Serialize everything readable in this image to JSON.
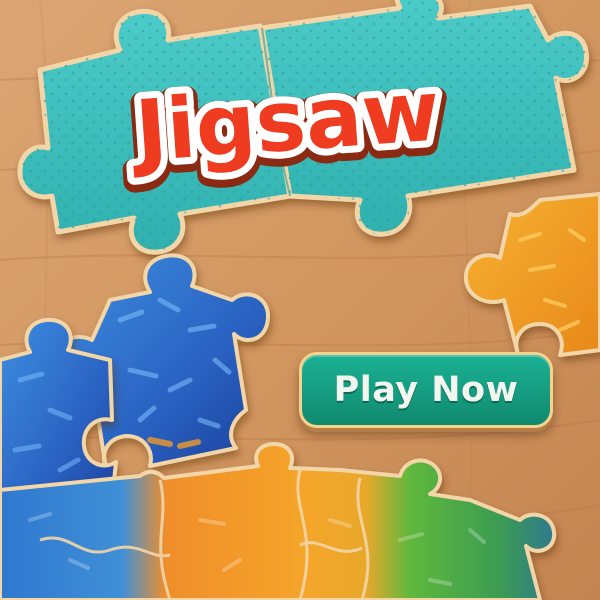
{
  "game": {
    "title": "Jigsaw",
    "play_button_label": "Play Now"
  },
  "colors": {
    "wood_background": "#d39a66",
    "title_pieces": "#3cbfbd",
    "title_text": "#ef3b1f",
    "title_text_outline": "#ffffff",
    "play_button": "#15a083",
    "piece_blue": "#2f74c9",
    "piece_orange": "#f09a22",
    "piece_green": "#4fb53a"
  }
}
